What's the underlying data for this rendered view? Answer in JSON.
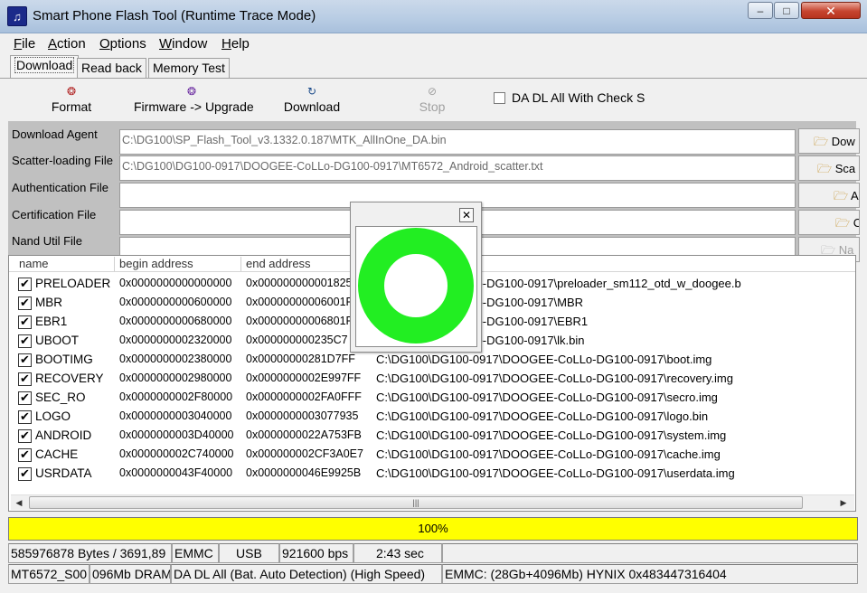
{
  "window": {
    "title": "Smart Phone Flash Tool (Runtime Trace Mode)",
    "minimize": "–",
    "maximize": "□",
    "close": "✕"
  },
  "menu": [
    "File",
    "Action",
    "Options",
    "Window",
    "Help"
  ],
  "tabs": [
    "Download",
    "Read back",
    "Memory Test"
  ],
  "toolbar": {
    "format": "Format",
    "firmware_upgrade": "Firmware -> Upgrade",
    "download": "Download",
    "stop": "Stop",
    "da_check_label": "DA DL All With Check S"
  },
  "files": {
    "download_agent_label": "Download Agent",
    "download_agent_value": "C:\\DG100\\SP_Flash_Tool_v3.1332.0.187\\MTK_AllInOne_DA.bin",
    "scatter_label": "Scatter-loading File",
    "scatter_value": "C:\\DG100\\DG100-0917\\DOOGEE-CoLLo-DG100-0917\\MT6572_Android_scatter.txt",
    "auth_label": "Authentication File",
    "auth_value": "",
    "cert_label": "Certification File",
    "cert_value": "",
    "nand_label": "Nand Util File",
    "nand_value": "",
    "btn_download_agent": "Dow",
    "btn_scatter": "Sca",
    "btn_auth": "A",
    "btn_cert": "C",
    "btn_nand": "Na"
  },
  "table": {
    "headers": [
      "name",
      "begin address",
      "end address"
    ],
    "rows": [
      {
        "name": "PRELOADER",
        "begin": "0x0000000000000000",
        "end": "0x000000000001825",
        "path": "17\\DOOGEE-CoLLo-DG100-0917\\preloader_sm112_otd_w_doogee.b",
        "checked": true
      },
      {
        "name": "MBR",
        "begin": "0x0000000000600000",
        "end": "0x00000000006001F",
        "path": "17\\DOOGEE-CoLLo-DG100-0917\\MBR",
        "checked": true
      },
      {
        "name": "EBR1",
        "begin": "0x0000000000680000",
        "end": "0x00000000006801F",
        "path": "17\\DOOGEE-CoLLo-DG100-0917\\EBR1",
        "checked": true
      },
      {
        "name": "UBOOT",
        "begin": "0x0000000002320000",
        "end": "0x000000000235C7",
        "path": "17\\DOOGEE-CoLLo-DG100-0917\\lk.bin",
        "checked": true
      },
      {
        "name": "BOOTIMG",
        "begin": "0x0000000002380000",
        "end": "0x00000000281D7FF",
        "path": "C:\\DG100\\DG100-0917\\DOOGEE-CoLLo-DG100-0917\\boot.img",
        "checked": true
      },
      {
        "name": "RECOVERY",
        "begin": "0x0000000002980000",
        "end": "0x0000000002E997FF",
        "path": "C:\\DG100\\DG100-0917\\DOOGEE-CoLLo-DG100-0917\\recovery.img",
        "checked": true
      },
      {
        "name": "SEC_RO",
        "begin": "0x0000000002F80000",
        "end": "0x0000000002FA0FFF",
        "path": "C:\\DG100\\DG100-0917\\DOOGEE-CoLLo-DG100-0917\\secro.img",
        "checked": true
      },
      {
        "name": "LOGO",
        "begin": "0x0000000003040000",
        "end": "0x0000000003077935",
        "path": "C:\\DG100\\DG100-0917\\DOOGEE-CoLLo-DG100-0917\\logo.bin",
        "checked": true
      },
      {
        "name": "ANDROID",
        "begin": "0x0000000003D40000",
        "end": "0x0000000022A753FB",
        "path": "C:\\DG100\\DG100-0917\\DOOGEE-CoLLo-DG100-0917\\system.img",
        "checked": true
      },
      {
        "name": "CACHE",
        "begin": "0x000000002C740000",
        "end": "0x000000002CF3A0E7",
        "path": "C:\\DG100\\DG100-0917\\DOOGEE-CoLLo-DG100-0917\\cache.img",
        "checked": true
      },
      {
        "name": "USRDATA",
        "begin": "0x0000000043F40000",
        "end": "0x0000000046E9925B",
        "path": "C:\\DG100\\DG100-0917\\DOOGEE-CoLLo-DG100-0917\\userdata.img",
        "checked": true
      }
    ]
  },
  "progress": {
    "text": "100%",
    "fraction": 1.0,
    "color": "#ffff00"
  },
  "status": {
    "bytes": "585976878 Bytes / 3691,89",
    "storage": "EMMC",
    "port": "USB",
    "baud": "921600 bps",
    "time": "2:43 sec",
    "chip": "MT6572_S00",
    "ram": "096Mb DRAM",
    "mode": "DA DL All (Bat. Auto Detection) (High Speed)",
    "emmc_info": "EMMC: (28Gb+4096Mb) HYNIX 0x483447316404"
  },
  "dialog": {
    "close": "✕",
    "ring_color": "#22ee22"
  },
  "icons": {
    "format": "format-icon",
    "firmware": "firmware-icon",
    "download": "download-arrow-icon",
    "stop": "stop-icon",
    "folder": "folder-icon"
  }
}
